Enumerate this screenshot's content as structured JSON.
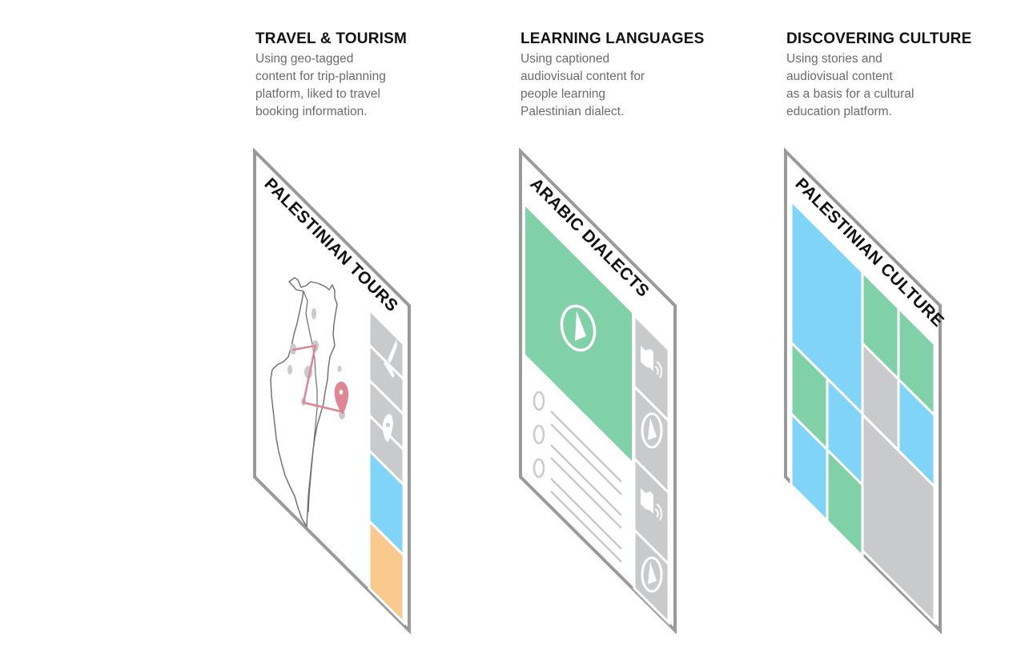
{
  "columns": [
    {
      "title": "TRAVEL & TOURISM",
      "lines": [
        "Using geo-tagged",
        "content for trip-planning",
        "platform, liked to travel",
        "booking information."
      ],
      "card_title": "PALESTINIAN TOURS"
    },
    {
      "title": "LEARNING LANGUAGES",
      "lines": [
        "Using captioned",
        "audiovisual content for",
        "people learning",
        "Palestinian dialect."
      ],
      "card_title": "ARABIC DIALECTS"
    },
    {
      "title": "DISCOVERING CULTURE",
      "lines": [
        "Using stories and",
        "audiovisual content",
        "as a basis for a cultural",
        "education platform."
      ],
      "card_title": "PALESTINIAN CULTURE"
    }
  ],
  "colors": {
    "frame": "#9a9a9b",
    "gray": "#c9cacc",
    "green": "#80d1a8",
    "blue": "#80d4f7",
    "orange": "#f9c98d",
    "route": "#e08594"
  },
  "icons": {
    "tours_sidebar": [
      "pencil-icon",
      "pin-icon"
    ],
    "dialects_sidebar": [
      "speaker-icon",
      "play-icon",
      "speaker-icon",
      "play-icon"
    ]
  }
}
